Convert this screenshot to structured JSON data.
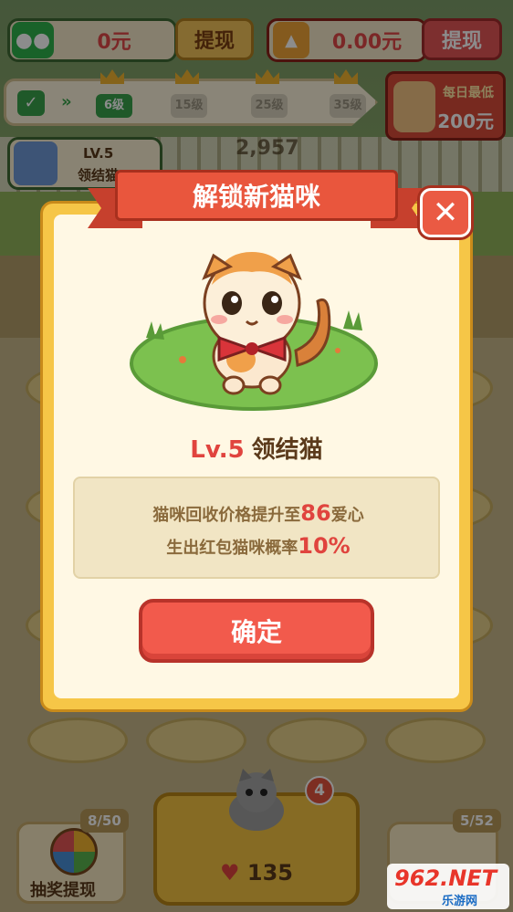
{
  "top_bar": {
    "wechat_balance": "0元",
    "withdraw_label": "提现",
    "redpacket_balance": "0.00元",
    "withdraw_label_2": "提现"
  },
  "level_bar": {
    "levels": [
      "6级",
      "15级",
      "25级",
      "35级"
    ]
  },
  "daily_reward": {
    "label": "每日最低",
    "amount": "200元"
  },
  "player": {
    "level": "LV.5",
    "title": "领结猫",
    "heart_total": "2,957"
  },
  "modal": {
    "title": "解锁新猫咪",
    "cat_level": "Lv.5",
    "cat_name": "领结猫",
    "line1_prefix": "猫咪回收价格提升至",
    "line1_value": "86",
    "line1_suffix": "爱心",
    "line2_prefix": "生出红包猫咪概率",
    "line2_value": "10%",
    "confirm_label": "确定",
    "close_glyph": "✕"
  },
  "bottom": {
    "draw_count": "8/50",
    "draw_label": "抽奖提现",
    "buy_price": "135",
    "buy_badge": "4",
    "album_count": "5/52"
  },
  "watermark": {
    "brand": "962.NET",
    "sub": "乐游网"
  },
  "colors": {
    "accent_red": "#e0443e",
    "panel_yellow": "#f6c647",
    "ribbon_red": "#e9563d"
  }
}
